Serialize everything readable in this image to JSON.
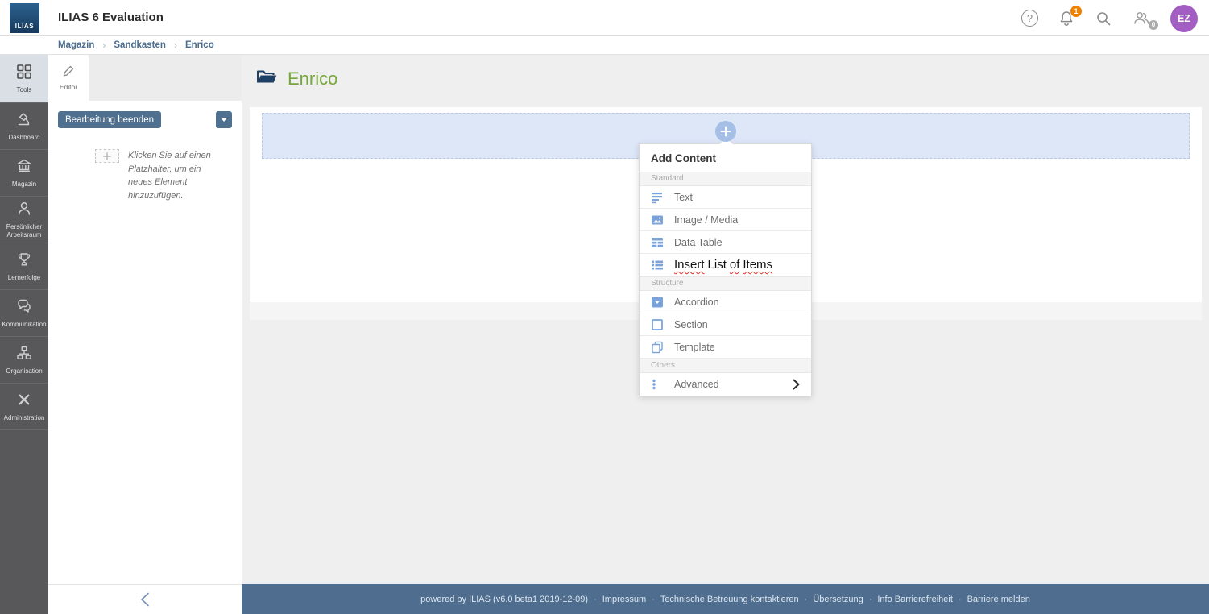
{
  "header": {
    "logo_text": "ILIAS",
    "title": "ILIAS 6 Evaluation",
    "help_glyph": "?",
    "notification_count": "1",
    "online_count": "0",
    "avatar_initials": "EZ"
  },
  "breadcrumb": {
    "separator": "›",
    "items": [
      {
        "label": "Magazin"
      },
      {
        "label": "Sandkasten"
      },
      {
        "label": "Enrico"
      }
    ]
  },
  "sidebar": {
    "items": [
      {
        "label": "Tools"
      },
      {
        "label": "Dashboard"
      },
      {
        "label": "Magazin"
      },
      {
        "label": "Persönlicher Arbeitsraum"
      },
      {
        "label": "Lernerfolge"
      },
      {
        "label": "Kommunikation"
      },
      {
        "label": "Organisation"
      },
      {
        "label": "Administration"
      }
    ]
  },
  "editor_panel": {
    "tab_label": "Editor",
    "finish_button_label": "Bearbeitung beenden",
    "placeholder_hint": "Klicken Sie auf einen Platzhalter, um ein neues Element hinzuzufügen."
  },
  "content": {
    "page_title": "Enrico"
  },
  "add_content_menu": {
    "title": "Add Content",
    "sections": {
      "standard": "Standard",
      "structure": "Structure",
      "others": "Others"
    },
    "items": {
      "text": "Text",
      "image": "Image / Media",
      "table": "Data Table",
      "list_words": [
        "Insert",
        "List",
        "of",
        "Items"
      ],
      "accordion": "Accordion",
      "section": "Section",
      "template": "Template",
      "advanced": "Advanced"
    }
  },
  "footer": {
    "separator": "·",
    "items": [
      "powered by ILIAS (v6.0 beta1 2019-12-09)",
      "Impressum",
      "Technische Betreuung kontaktieren",
      "Übersetzung",
      "Info Barrierefreiheit",
      "Barriere melden"
    ]
  },
  "colors": {
    "accent_slate": "#50708f",
    "brand_navy": "#1d4a73",
    "title_green": "#74a73c",
    "avatar_purple": "#a35ec3",
    "badge_orange": "#f08100",
    "menu_icon_blue": "#7aa3dc",
    "dropzone_blue": "#dde7f8",
    "sidebar_gray": "#58585a"
  }
}
